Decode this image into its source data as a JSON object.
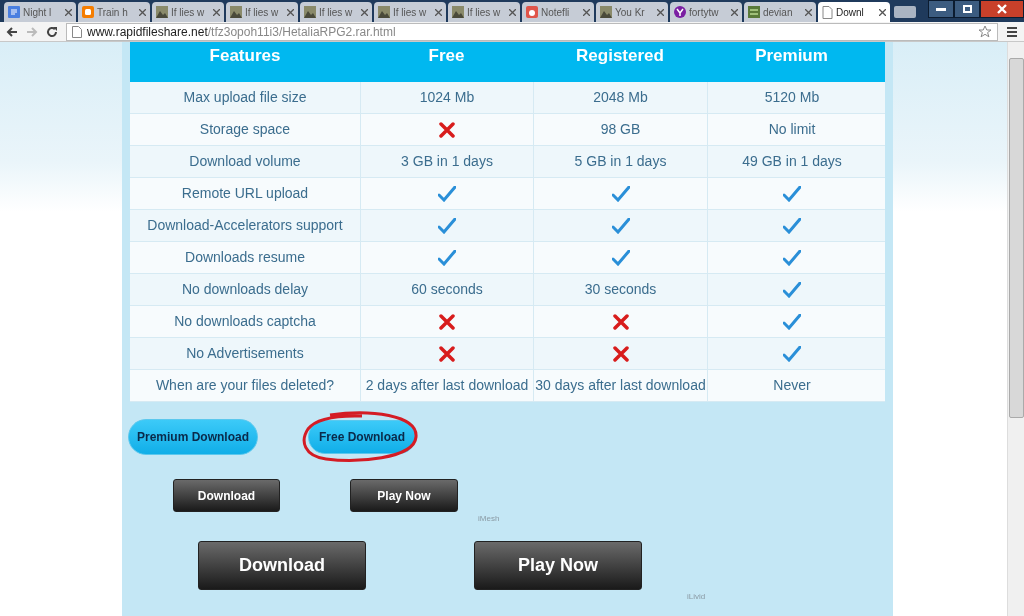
{
  "tabs": [
    {
      "label": "Night l",
      "selected": false
    },
    {
      "label": "Train h",
      "selected": false
    },
    {
      "label": "If lies w",
      "selected": false
    },
    {
      "label": "If lies w",
      "selected": false
    },
    {
      "label": "If lies w",
      "selected": false
    },
    {
      "label": "If lies w",
      "selected": false
    },
    {
      "label": "If lies w",
      "selected": false
    },
    {
      "label": "Notefli",
      "selected": false
    },
    {
      "label": "You Kr",
      "selected": false
    },
    {
      "label": "fortytw",
      "selected": false
    },
    {
      "label": "devian",
      "selected": false
    },
    {
      "label": "Downl",
      "selected": true
    }
  ],
  "address": {
    "host": "www.rapidfileshare.net",
    "path": "/tfz3opoh11i3/HetaliaRPG2.rar.html"
  },
  "table": {
    "columns": [
      "Features",
      "Free",
      "Registered",
      "Premium"
    ],
    "rows": [
      {
        "cells": [
          {
            "kind": "text",
            "text": "Max upload file size"
          },
          {
            "kind": "text",
            "text": "1024 Mb"
          },
          {
            "kind": "text",
            "text": "2048 Mb"
          },
          {
            "kind": "text",
            "text": "5120 Mb"
          }
        ]
      },
      {
        "cells": [
          {
            "kind": "text",
            "text": "Storage space"
          },
          {
            "kind": "cross"
          },
          {
            "kind": "text",
            "text": "98 GB"
          },
          {
            "kind": "text",
            "text": "No limit"
          }
        ]
      },
      {
        "cells": [
          {
            "kind": "text",
            "text": "Download volume"
          },
          {
            "kind": "text",
            "text": "3 GB in 1 days"
          },
          {
            "kind": "text",
            "text": "5 GB in 1 days"
          },
          {
            "kind": "text",
            "text": "49 GB in 1 days"
          }
        ]
      },
      {
        "cells": [
          {
            "kind": "text",
            "text": "Remote URL upload"
          },
          {
            "kind": "check"
          },
          {
            "kind": "check"
          },
          {
            "kind": "check"
          }
        ]
      },
      {
        "cells": [
          {
            "kind": "text",
            "text": "Download-Accelerators support"
          },
          {
            "kind": "check"
          },
          {
            "kind": "check"
          },
          {
            "kind": "check"
          }
        ]
      },
      {
        "cells": [
          {
            "kind": "text",
            "text": "Downloads resume"
          },
          {
            "kind": "check"
          },
          {
            "kind": "check"
          },
          {
            "kind": "check"
          }
        ]
      },
      {
        "cells": [
          {
            "kind": "text",
            "text": "No downloads delay"
          },
          {
            "kind": "text",
            "text": "60 seconds"
          },
          {
            "kind": "text",
            "text": "30 seconds"
          },
          {
            "kind": "check"
          }
        ]
      },
      {
        "cells": [
          {
            "kind": "text",
            "text": "No downloads captcha"
          },
          {
            "kind": "cross"
          },
          {
            "kind": "cross"
          },
          {
            "kind": "check"
          }
        ]
      },
      {
        "cells": [
          {
            "kind": "text",
            "text": "No Advertisements"
          },
          {
            "kind": "cross"
          },
          {
            "kind": "cross"
          },
          {
            "kind": "check"
          }
        ]
      },
      {
        "cells": [
          {
            "kind": "text",
            "text": "When are your files deleted?"
          },
          {
            "kind": "text",
            "text": "2 days after last download"
          },
          {
            "kind": "text",
            "text": "30 days after last download"
          },
          {
            "kind": "text",
            "text": "Never"
          }
        ]
      }
    ]
  },
  "plan_buttons": [
    "Premium Download",
    "Free Download"
  ],
  "ads": [
    {
      "download": "Download",
      "play": "Play Now",
      "sponsor": "iMesh"
    },
    {
      "download": "Download",
      "play": "Play Now",
      "sponsor": "iLivid"
    }
  ]
}
